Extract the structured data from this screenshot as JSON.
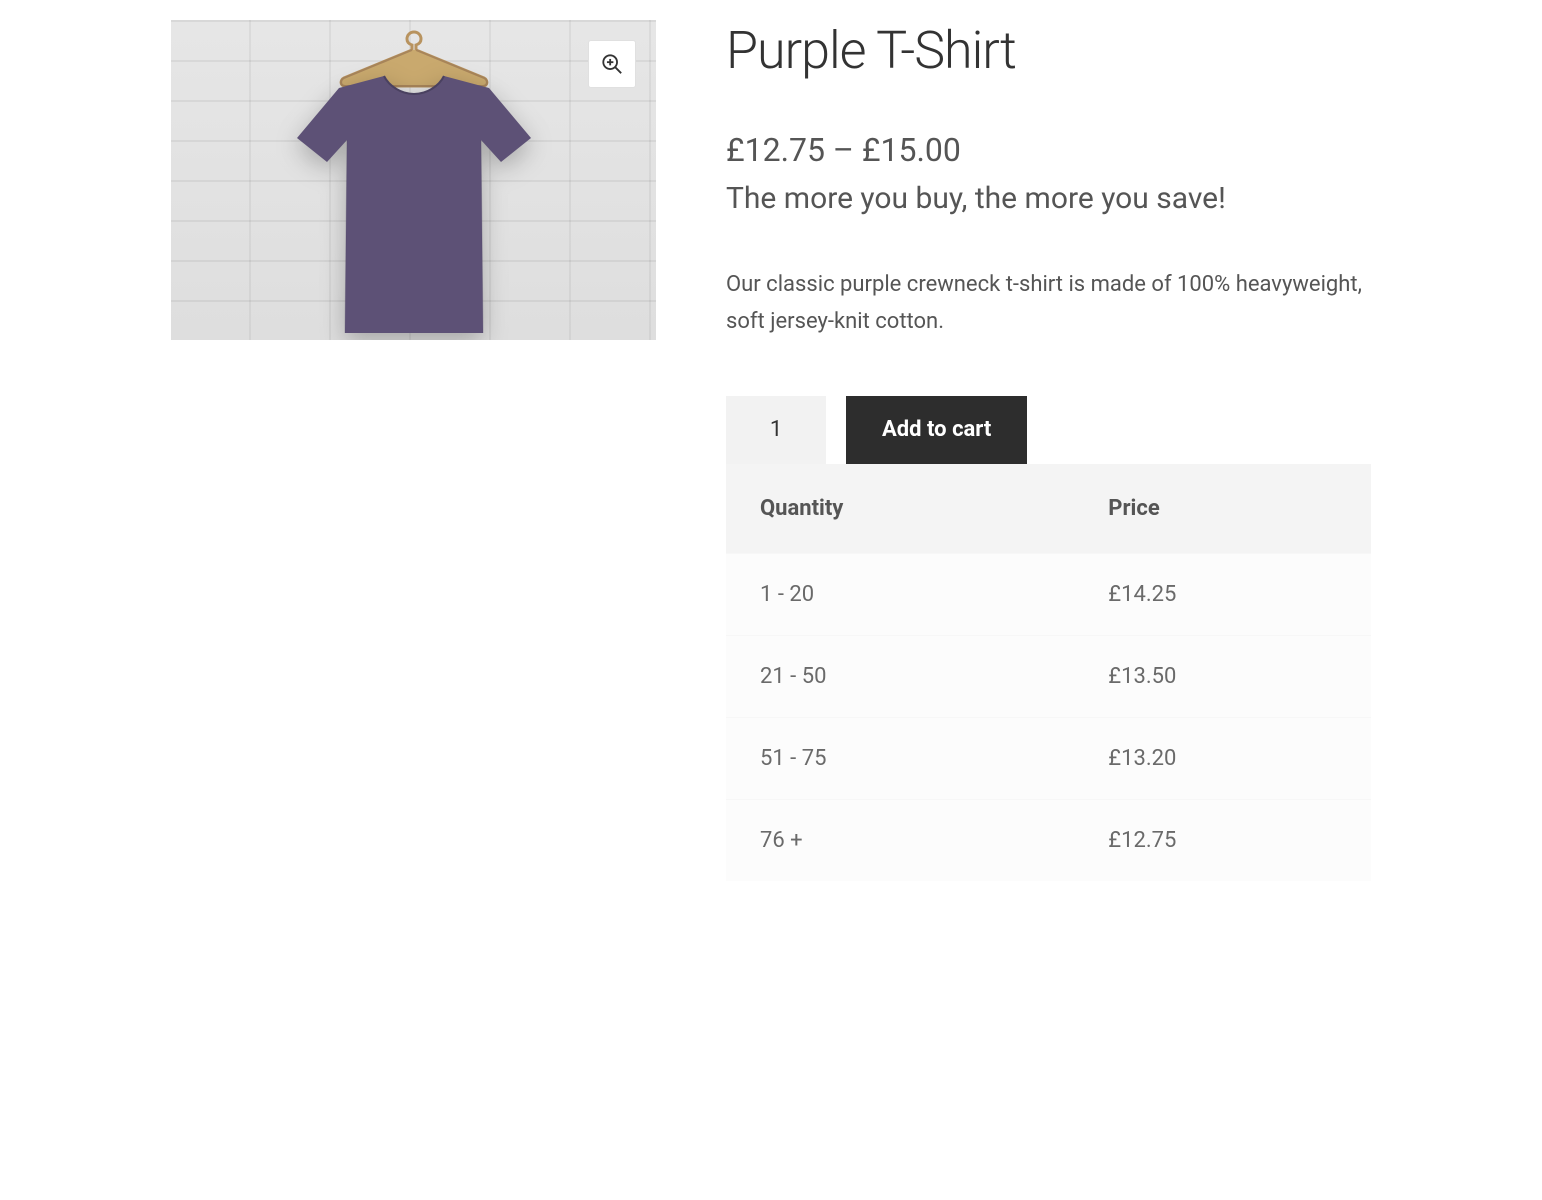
{
  "product": {
    "title": "Purple T-Shirt",
    "price_range": "£12.75 – £15.00",
    "promo_text": "The more you buy, the more you save!",
    "description": "Our classic purple crewneck t-shirt is made of 100% heavyweight, soft jersey-knit cotton.",
    "tshirt_color": "#5d5176",
    "hanger_color": "#c9a96e"
  },
  "cart": {
    "quantity_value": "1",
    "add_to_cart_label": "Add to cart"
  },
  "pricing_table": {
    "headers": {
      "quantity": "Quantity",
      "price": "Price"
    },
    "rows": [
      {
        "quantity": "1 - 20",
        "price": "£14.25"
      },
      {
        "quantity": "21 - 50",
        "price": "£13.50"
      },
      {
        "quantity": "51 - 75",
        "price": "£13.20"
      },
      {
        "quantity": "76 +",
        "price": "£12.75"
      }
    ]
  },
  "icons": {
    "zoom": "zoom-in-icon"
  }
}
